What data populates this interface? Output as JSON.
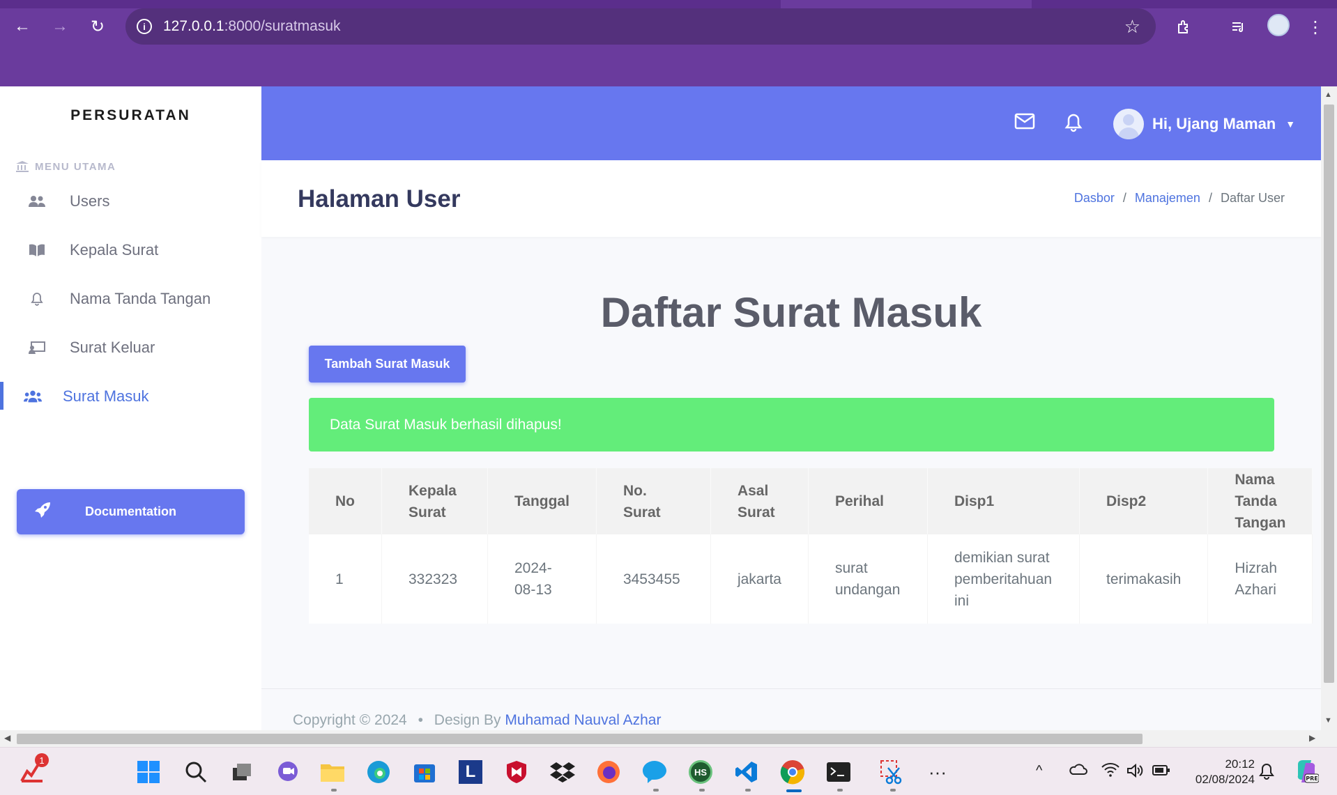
{
  "browser": {
    "url_host": "127.0.0.1",
    "url_path": ":8000/suratmasuk"
  },
  "sidebar": {
    "brand": "PERSURATAN",
    "menu_heading": "MENU UTAMA",
    "items": [
      {
        "label": "Users",
        "icon": "users-icon"
      },
      {
        "label": "Kepala Surat",
        "icon": "book-icon"
      },
      {
        "label": "Nama Tanda Tangan",
        "icon": "bell-icon"
      },
      {
        "label": "Surat Keluar",
        "icon": "chalkboard-icon"
      },
      {
        "label": "Surat Masuk",
        "icon": "users-icon",
        "active": true
      }
    ],
    "doc_button": "Documentation"
  },
  "topbar": {
    "user_greeting": "Hi, Ujang Maman"
  },
  "header": {
    "title": "Halaman User",
    "breadcrumb": [
      "Dasbor",
      "Manajemen",
      "Daftar User"
    ]
  },
  "main": {
    "heading": "Daftar Surat Masuk",
    "add_button": "Tambah Surat Masuk",
    "alert": "Data Surat Masuk berhasil dihapus!",
    "table": {
      "columns": [
        "No",
        "Kepala Surat",
        "Tanggal",
        "No. Surat",
        "Asal Surat",
        "Perihal",
        "Disp1",
        "Disp2",
        "Nama Tanda Tangan"
      ],
      "rows": [
        [
          "1",
          "332323",
          "2024-08-13",
          "3453455",
          "jakarta",
          "surat undangan",
          "demikian surat pemberitahuan ini",
          "terimakasih",
          "Hizrah Azhari"
        ]
      ]
    }
  },
  "footer": {
    "copyright": "Copyright © 2024",
    "bullet": "•",
    "design_by": "Design By",
    "credit": "Muhamad Nauval Azhar"
  },
  "taskbar": {
    "notification_badge": "1",
    "time": "20:12",
    "date": "02/08/2024"
  },
  "colors": {
    "primary": "#6777ef",
    "success": "#63ed7a",
    "browser": "#6a3b9d"
  }
}
